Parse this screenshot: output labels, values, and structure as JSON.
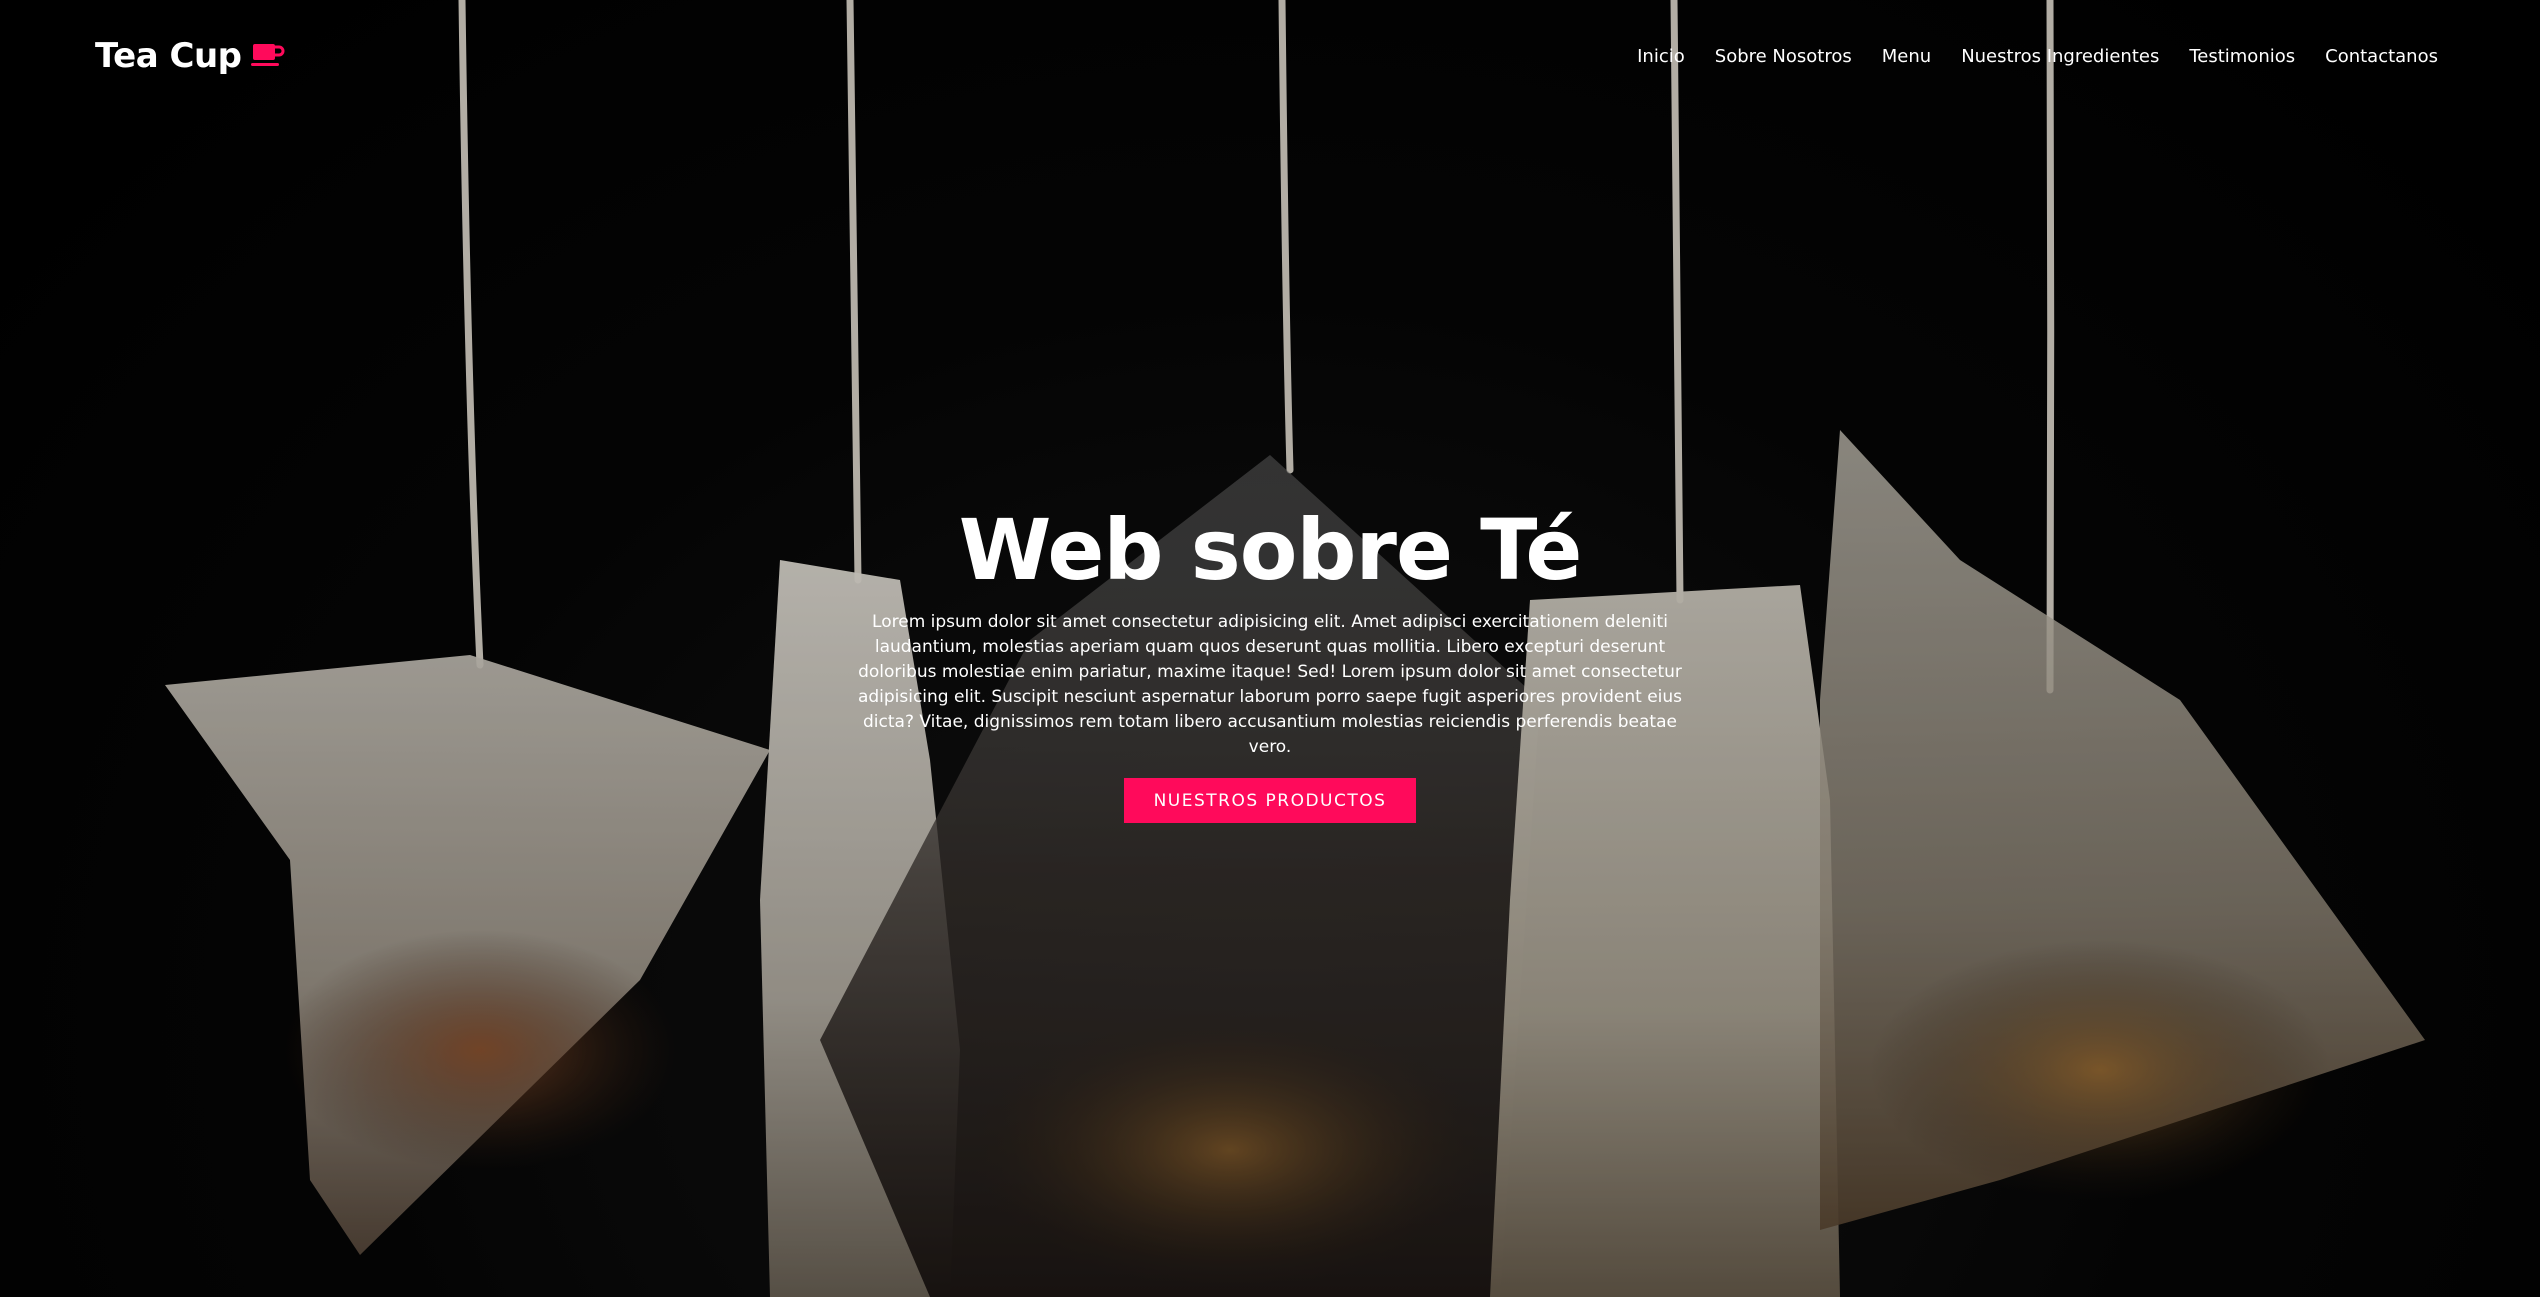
{
  "header": {
    "logo_text": "Tea Cup",
    "logo_icon": "coffee-cup-icon",
    "nav": [
      {
        "label": "Inicio"
      },
      {
        "label": "Sobre Nosotros"
      },
      {
        "label": "Menu"
      },
      {
        "label": "Nuestros Ingredientes"
      },
      {
        "label": "Testimonios"
      },
      {
        "label": "Contactanos"
      }
    ]
  },
  "hero": {
    "title": "Web sobre Té",
    "text": "Lorem ipsum dolor sit amet consectetur adipisicing elit. Amet adipisci exercitationem deleniti laudantium, molestias aperiam quam quos deserunt quas mollitia. Libero excepturi deserunt doloribus molestiae enim pariatur, maxime itaque! Sed! Lorem ipsum dolor sit amet consectetur adipisicing elit. Suscipit nesciunt aspernatur laborum porro saepe fugit asperiores provident eius dicta? Vitae, dignissimos rem totam libero accusantium molestias reiciendis perferendis beatae vero.",
    "cta_label": "NUESTROS PRODUCTOS",
    "background": "hanging-tea-bags-photo"
  },
  "colors": {
    "accent": "#ff0a5b",
    "text": "#ffffff",
    "background": "#000000"
  }
}
